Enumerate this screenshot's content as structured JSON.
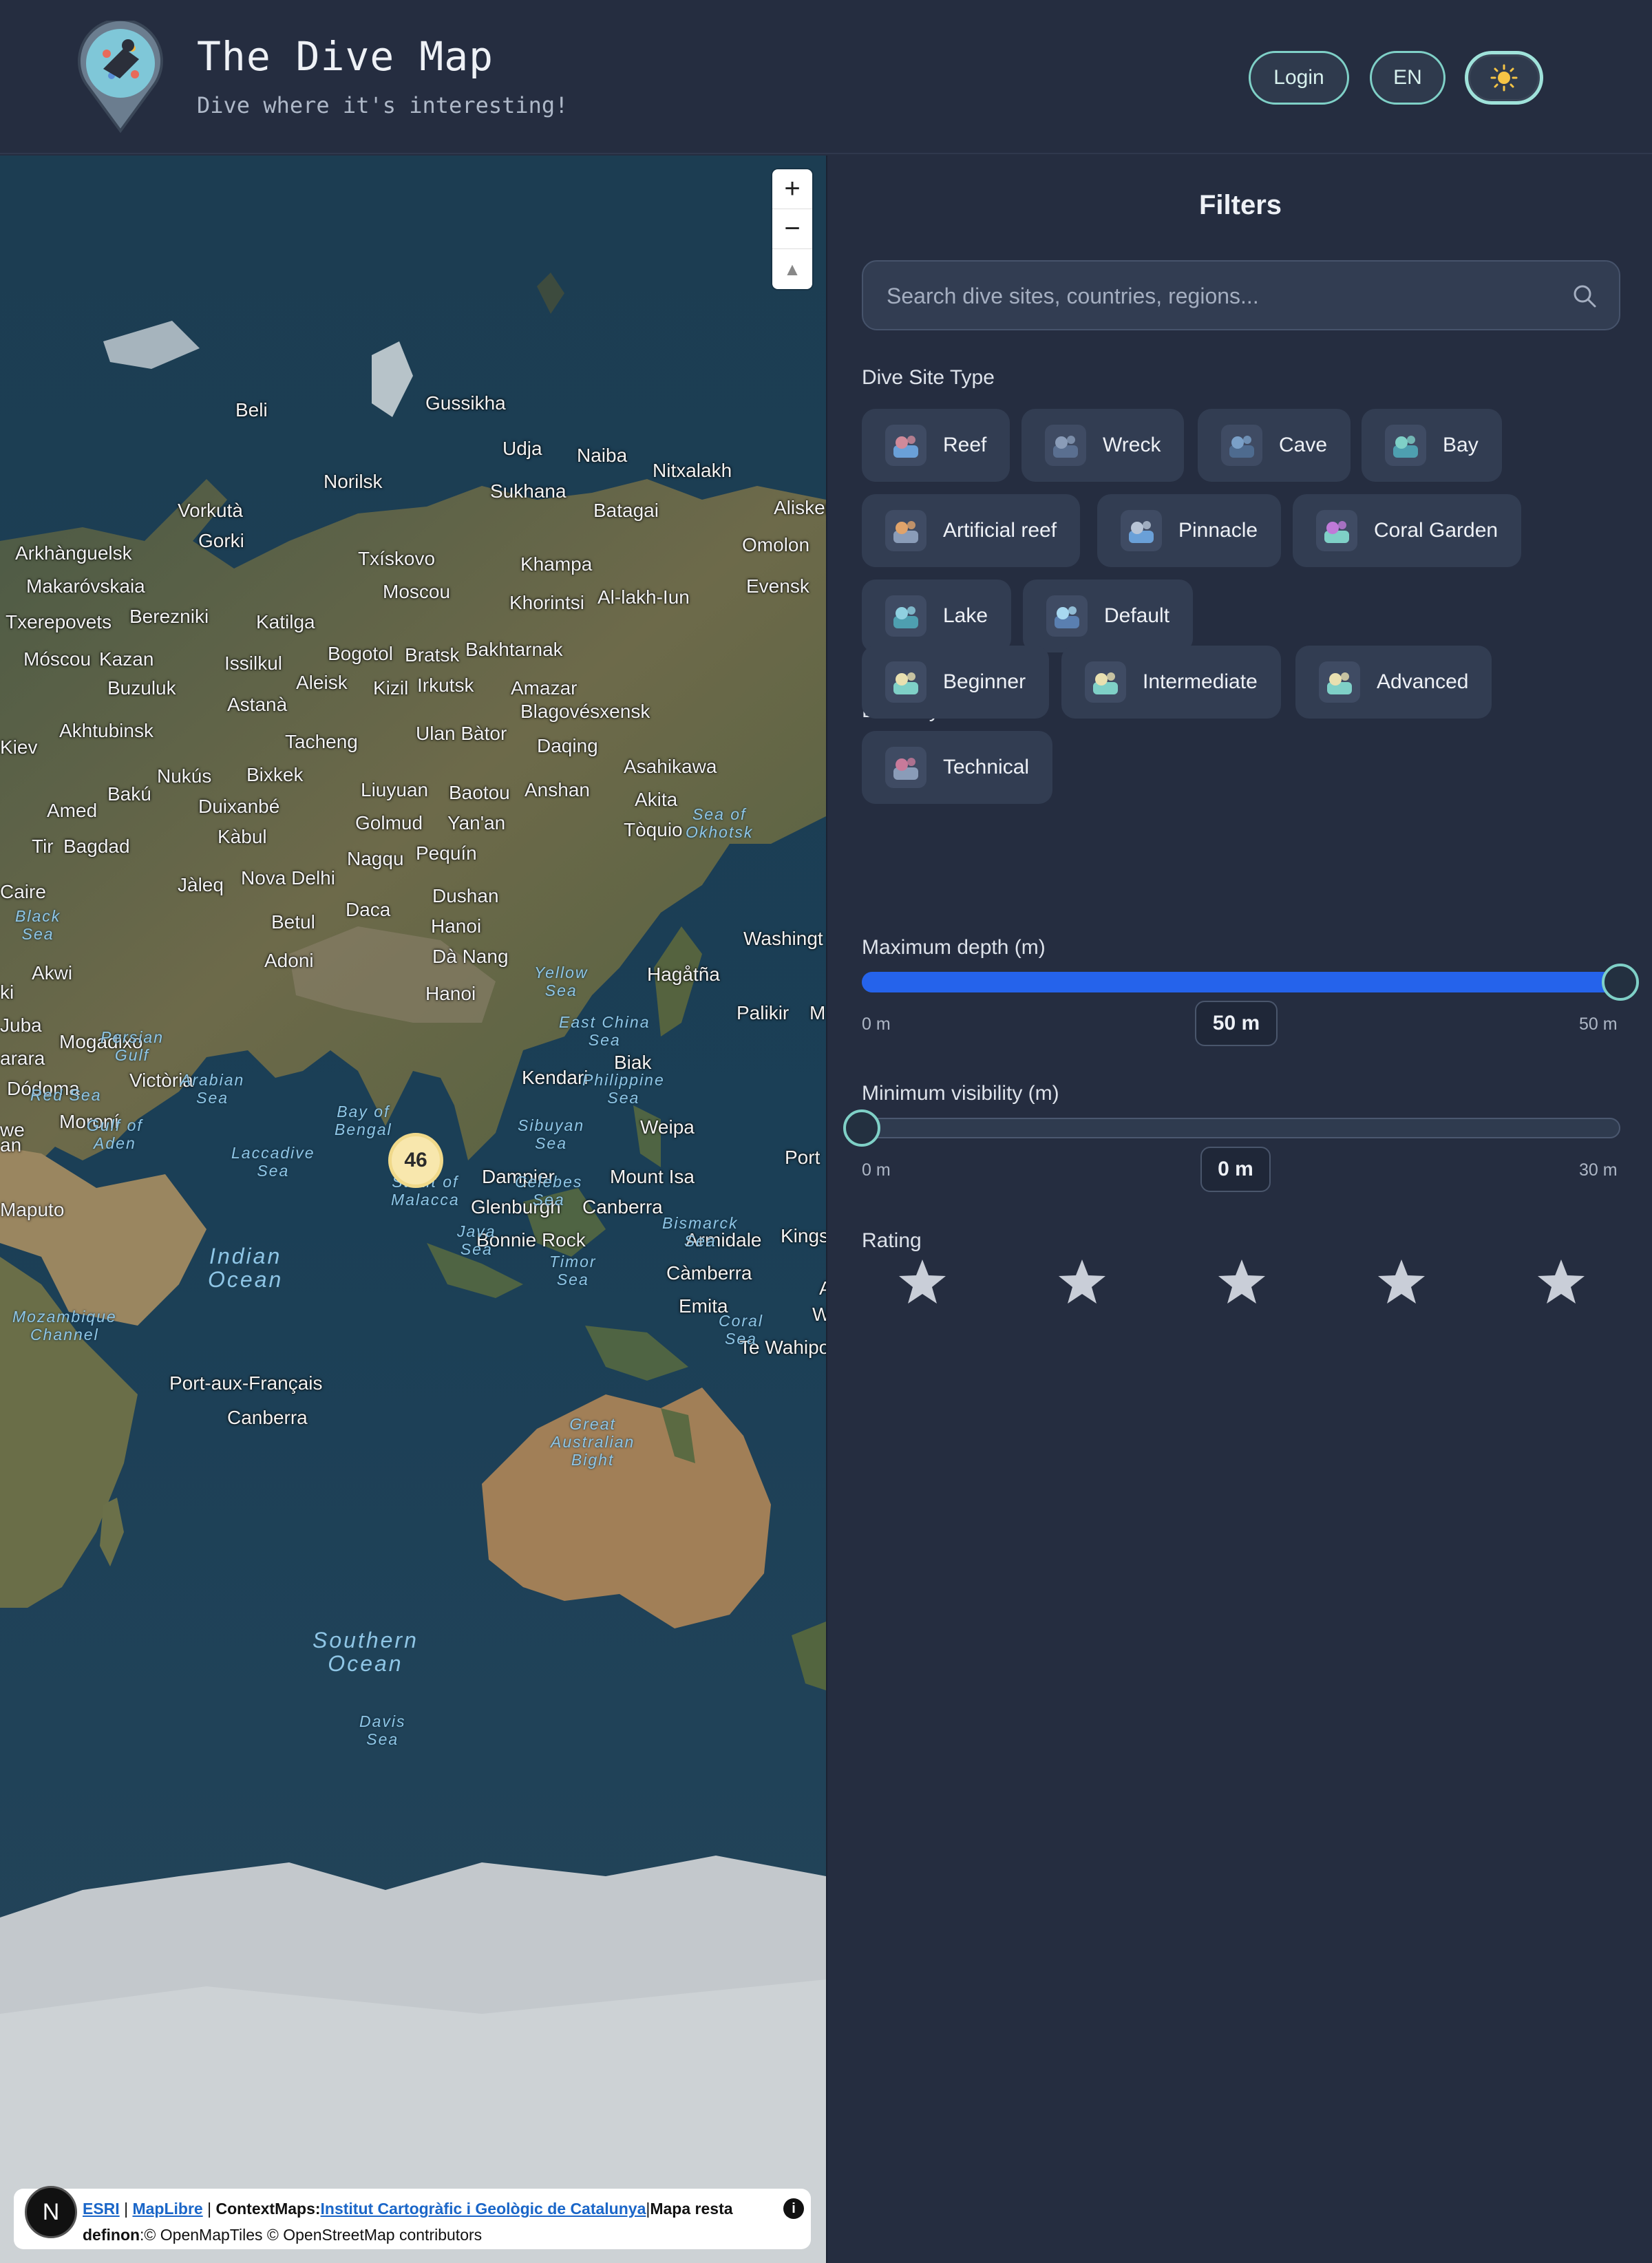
{
  "header": {
    "title": "The Dive Map",
    "subtitle": "Dive where it's interesting!",
    "login_label": "Login",
    "language_label": "EN",
    "theme_icon": "sun-icon"
  },
  "map": {
    "cluster_count": "46",
    "zoom_in_label": "+",
    "zoom_out_label": "−",
    "compass_label": "▲",
    "labels": [
      {
        "text": "Gussikha"
      },
      {
        "text": "Beli"
      },
      {
        "text": "Udja"
      },
      {
        "text": "Naiba"
      },
      {
        "text": "Nitxalakh"
      },
      {
        "text": "Norilsk"
      },
      {
        "text": "Sukhana"
      },
      {
        "text": "Batagai"
      },
      {
        "text": "Alisker"
      },
      {
        "text": "Vorkutà"
      },
      {
        "text": "Arkhànguelsk"
      },
      {
        "text": "Gorki"
      },
      {
        "text": "Txískovo"
      },
      {
        "text": "Khampa"
      },
      {
        "text": "Omolon"
      },
      {
        "text": "Makaróvskaia"
      },
      {
        "text": "Moscou"
      },
      {
        "text": "Khorintsi"
      },
      {
        "text": "Al-lakh-Iun"
      },
      {
        "text": "Evensk"
      },
      {
        "text": "Txerepovets"
      },
      {
        "text": "Berezniki"
      },
      {
        "text": "Katilga"
      },
      {
        "text": "Bogotol"
      },
      {
        "text": "Bratsk"
      },
      {
        "text": "Bakhtarnak"
      },
      {
        "text": "Móscou"
      },
      {
        "text": "Kazan"
      },
      {
        "text": "Issilkul"
      },
      {
        "text": "Amazar"
      },
      {
        "text": "Buzuluk"
      },
      {
        "text": "Aleisk"
      },
      {
        "text": "Kizil"
      },
      {
        "text": "Irkutsk"
      },
      {
        "text": "Astanà"
      },
      {
        "text": "Blagovésxensk"
      },
      {
        "text": "Kiev"
      },
      {
        "text": "Akhtubinsk"
      },
      {
        "text": "Tacheng"
      },
      {
        "text": "Ulan Bàtor"
      },
      {
        "text": "Daqing"
      },
      {
        "text": "Asahikawa"
      },
      {
        "text": "Nukús"
      },
      {
        "text": "Bixkek"
      },
      {
        "text": "Bakú"
      },
      {
        "text": "Liuyuan"
      },
      {
        "text": "Baotou"
      },
      {
        "text": "Anshan"
      },
      {
        "text": "Akita"
      },
      {
        "text": "Amed"
      },
      {
        "text": "Duixanbé"
      },
      {
        "text": "Golmud"
      },
      {
        "text": "Yan'an"
      },
      {
        "text": "Tòquio"
      },
      {
        "text": "Kàbul"
      },
      {
        "text": "Tir"
      },
      {
        "text": "Bagdad"
      },
      {
        "text": "Nagqu"
      },
      {
        "text": "Pequín"
      },
      {
        "text": "Caire"
      },
      {
        "text": "Jàleq"
      },
      {
        "text": "Nova Delhi"
      },
      {
        "text": "Daca"
      },
      {
        "text": "Dushan"
      },
      {
        "text": "Betul"
      },
      {
        "text": "Hanoi"
      },
      {
        "text": "Washingt"
      },
      {
        "text": "Akwi"
      },
      {
        "text": "Adoni"
      },
      {
        "text": "Dà Nang"
      },
      {
        "text": "Hagåtña"
      },
      {
        "text": "Hanoi"
      },
      {
        "text": "Palikir"
      },
      {
        "text": "M"
      },
      {
        "text": "Juba"
      },
      {
        "text": "Mogadixo"
      },
      {
        "text": "Biak"
      },
      {
        "text": "arara"
      },
      {
        "text": "Victòria"
      },
      {
        "text": "Kendari"
      },
      {
        "text": "Dódoma"
      },
      {
        "text": "Moroní"
      },
      {
        "text": "Weipa"
      },
      {
        "text": "we"
      },
      {
        "text": "Port"
      },
      {
        "text": "Dampier"
      },
      {
        "text": "Mount Isa"
      },
      {
        "text": "Maputo"
      },
      {
        "text": "Glenburgh"
      },
      {
        "text": "Canberra"
      },
      {
        "text": "Bonnie Rock"
      },
      {
        "text": "Armidale"
      },
      {
        "text": "Kings"
      },
      {
        "text": "Càmberra"
      },
      {
        "text": "Emita"
      },
      {
        "text": "Te Wahipo"
      },
      {
        "text": "Port-aux-Français"
      },
      {
        "text": "Canberra"
      },
      {
        "text": "an"
      },
      {
        "text": "ki"
      },
      {
        "text": "W"
      },
      {
        "text": "A"
      }
    ],
    "seas": [
      {
        "text": "Black\nSea"
      },
      {
        "text": "Persian\nGulf"
      },
      {
        "text": "Red Sea"
      },
      {
        "text": "Gulf of\nAden"
      },
      {
        "text": "Arabian\nSea"
      },
      {
        "text": "Bay of\nBengal"
      },
      {
        "text": "Laccadive\nSea"
      },
      {
        "text": "Strait of\nMalacca"
      },
      {
        "text": "Java\nSea"
      },
      {
        "text": "Celebes\nSea"
      },
      {
        "text": "Sibuyan\nSea"
      },
      {
        "text": "Philippine\nSea"
      },
      {
        "text": "East China\nSea"
      },
      {
        "text": "Yellow\nSea"
      },
      {
        "text": "Sea of\nOkhotsk"
      },
      {
        "text": "Timor\nSea"
      },
      {
        "text": "Bismarck\nSea"
      },
      {
        "text": "Coral\nSea"
      },
      {
        "text": "Great\nAustralian\nBight"
      },
      {
        "text": "Mozambique\nChannel"
      },
      {
        "text": "Davis\nSea"
      }
    ],
    "oceans": [
      {
        "text": "Indian\nOcean"
      },
      {
        "text": "Southern\nOcean"
      }
    ],
    "attribution": {
      "prefix": "",
      "esri": "ESRI",
      "sep1": "|",
      "maplibre": "MapLibre",
      "sep2": "|",
      "context": "ContextMaps:",
      "icgc": "Institut Cartogràfic i Geològic de Catalunya",
      "sep3": "|",
      "rest": "Mapa resta",
      "line2a": "definon",
      "line2b": ":© OpenMapTiles © OpenStreetMap contributors",
      "logo_letter": "N",
      "info_icon": "i"
    }
  },
  "filters": {
    "title": "Filters",
    "search_placeholder": "Search dive sites, countries, regions...",
    "site_type_label": "Dive Site Type",
    "site_types": [
      {
        "label": "Reef",
        "icon": "reef-icon"
      },
      {
        "label": "Wreck",
        "icon": "wreck-icon"
      },
      {
        "label": "Cave",
        "icon": "cave-icon"
      },
      {
        "label": "Bay",
        "icon": "bay-icon"
      },
      {
        "label": "Artificial reef",
        "icon": "artificial-reef-icon"
      },
      {
        "label": "Pinnacle",
        "icon": "pinnacle-icon"
      },
      {
        "label": "Coral Garden",
        "icon": "coral-garden-icon"
      },
      {
        "label": "Lake",
        "icon": "lake-icon"
      },
      {
        "label": "Default",
        "icon": "snorkel-mask-icon"
      }
    ],
    "difficulty_label": "Difficulty Level",
    "difficulties": [
      {
        "label": "Beginner",
        "icon": "one-tank-icon"
      },
      {
        "label": "Intermediate",
        "icon": "two-tanks-icon"
      },
      {
        "label": "Advanced",
        "icon": "three-tanks-icon"
      },
      {
        "label": "Technical",
        "icon": "diver-rig-icon"
      }
    ],
    "max_depth": {
      "label": "Maximum depth (m)",
      "min_label": "0 m",
      "max_label": "50 m",
      "value_label": "50 m",
      "fill_fraction": 1.0,
      "accent": "#2563eb"
    },
    "min_visibility": {
      "label": "Minimum visibility (m)",
      "min_label": "0 m",
      "max_label": "30 m",
      "value_label": "0 m",
      "fill_fraction": 0.0
    },
    "rating": {
      "label": "Rating",
      "stars": 5,
      "selected": 0,
      "star_color": "#c9ced8"
    }
  }
}
